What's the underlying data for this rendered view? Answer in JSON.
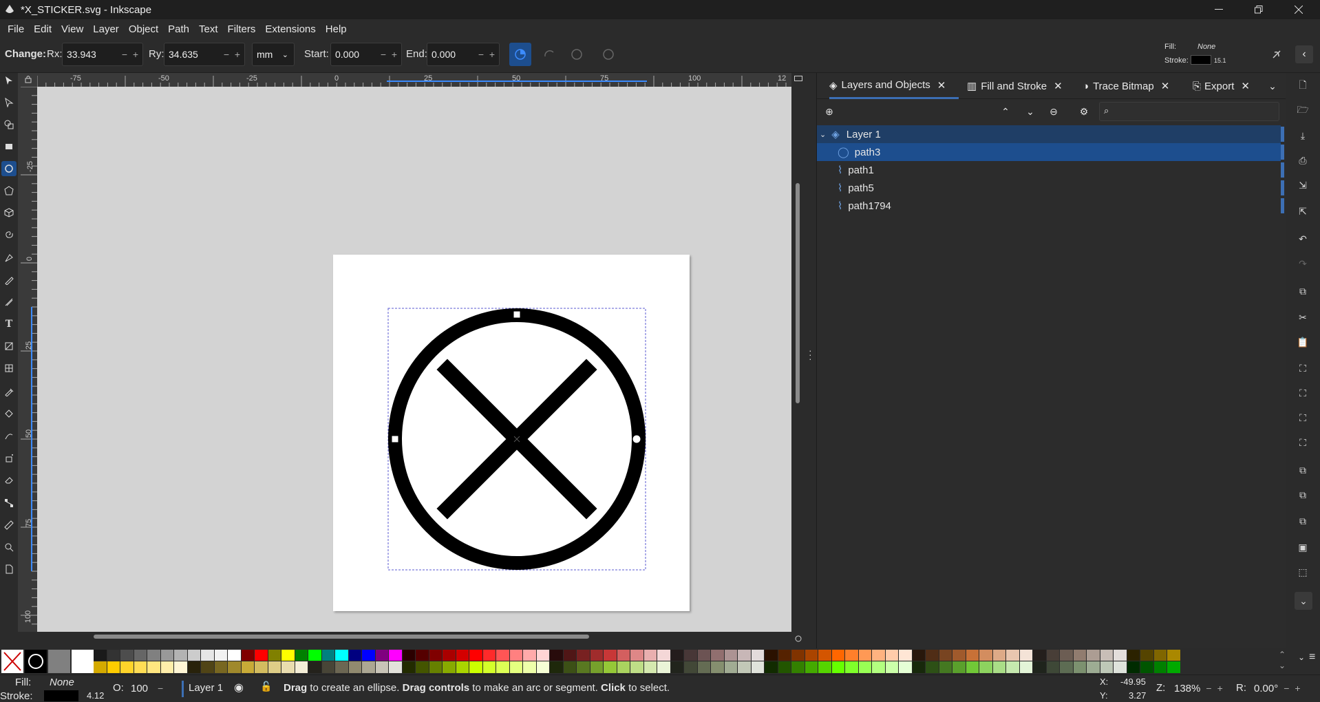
{
  "window": {
    "title": "*X_STICKER.svg - Inkscape"
  },
  "menu": [
    "File",
    "Edit",
    "View",
    "Layer",
    "Object",
    "Path",
    "Text",
    "Filters",
    "Extensions",
    "Help"
  ],
  "toolctl": {
    "change": "Change:",
    "rx_label": "Rx:",
    "rx": "33.943",
    "ry_label": "Ry:",
    "ry": "34.635",
    "unit": "mm",
    "start_label": "Start:",
    "start": "0.000",
    "end_label": "End:",
    "end": "0.000"
  },
  "style_indicator": {
    "fill_label": "Fill:",
    "fill_value": "None",
    "stroke_label": "Stroke:",
    "stroke_width": "15.1"
  },
  "ruler_top": [
    "-75",
    "-50",
    "-25",
    "0",
    "25",
    "50",
    "75",
    "100",
    "12"
  ],
  "ruler_left": [
    "-25",
    "0",
    "25",
    "50",
    "75",
    "100"
  ],
  "tabs": [
    {
      "label": "Layers and Objects",
      "icon": "layers-icon"
    },
    {
      "label": "Fill and Stroke",
      "icon": "fill-stroke-icon"
    },
    {
      "label": "Trace Bitmap",
      "icon": "trace-bitmap-icon"
    },
    {
      "label": "Export",
      "icon": "export-icon"
    }
  ],
  "layers": [
    {
      "label": "Layer 1",
      "type": "layer"
    },
    {
      "label": "path3",
      "type": "ellipse"
    },
    {
      "label": "path1",
      "type": "path"
    },
    {
      "label": "path5",
      "type": "path"
    },
    {
      "label": "path1794",
      "type": "path"
    }
  ],
  "status": {
    "fill_label": "Fill:",
    "fill_value": "None",
    "stroke_label": "Stroke:",
    "stroke_width": "4.12",
    "opacity_label": "O:",
    "opacity": "100",
    "layer": "Layer 1",
    "message_b1": "Drag",
    "message_t1": " to create an ellipse. ",
    "message_b2": "Drag controls",
    "message_t2": " to make an arc or segment. ",
    "message_b3": "Click",
    "message_t3": " to select.",
    "x_label": "X:",
    "x": "-49.95",
    "y_label": "Y:",
    "y": "3.27",
    "zoom_label": "Z:",
    "zoom": "138%",
    "rot_label": "R:",
    "rotation": "0.00°"
  },
  "colors": {
    "accent": "#3c6fb4",
    "selected_row": "#1d4e8e",
    "palette_row1": [
      "#1a1a1a",
      "#333333",
      "#4d4d4d",
      "#666666",
      "#808080",
      "#999999",
      "#b3b3b3",
      "#cccccc",
      "#e6e6e6",
      "#f2f2f2",
      "#ffffff",
      "#800000",
      "#ff0000",
      "#808000",
      "#ffff00",
      "#008000",
      "#00ff00",
      "#008080",
      "#00ffff",
      "#000080",
      "#0000ff",
      "#800080",
      "#ff00ff",
      "#2b0000",
      "#550000",
      "#800000",
      "#aa0000",
      "#d40000",
      "#ff0000",
      "#ff2a2a",
      "#ff5555",
      "#ff8080",
      "#ffaaaa",
      "#ffd5d5",
      "#280b0b",
      "#501616",
      "#782121",
      "#a02c2c",
      "#c83737",
      "#d35f5f",
      "#de8787",
      "#e9afaf",
      "#f4d7d7",
      "#241c1c",
      "#483737",
      "#6c5353",
      "#916f6f",
      "#ac9393",
      "#c8b7b7",
      "#e3dbdb",
      "#2b1100",
      "#552200",
      "#803300",
      "#aa4400",
      "#d45500",
      "#ff6600",
      "#ff7f2a",
      "#ff9955",
      "#ffb380",
      "#ffccaa",
      "#ffe6d5",
      "#28170b",
      "#502d16",
      "#784421",
      "#a05a2c",
      "#c87137",
      "#d38d5f",
      "#deaa87",
      "#e9c6af",
      "#f4e3d7",
      "#241f1c",
      "#483e37",
      "#6c5d53",
      "#917c6f",
      "#ac9d93",
      "#c8beb7",
      "#e3dedb",
      "#2b2200",
      "#554400",
      "#806600",
      "#aa8800"
    ],
    "palette_row2": [
      "#d4aa00",
      "#ffcc00",
      "#ffd42a",
      "#ffdd55",
      "#ffe680",
      "#ffeeaa",
      "#fff6d5",
      "#28220b",
      "#504416",
      "#786721",
      "#a0892c",
      "#c8ab37",
      "#d3bc5f",
      "#decd87",
      "#e9ddaf",
      "#f4eed7",
      "#24221c",
      "#484537",
      "#6c6753",
      "#918a6f",
      "#aca793",
      "#c8c4b7",
      "#e3e2db",
      "#222b00",
      "#445500",
      "#668000",
      "#88aa00",
      "#aad400",
      "#ccff00",
      "#d4ff2a",
      "#ddff55",
      "#e5ff80",
      "#eeffaa",
      "#f6ffd5",
      "#1e280b",
      "#3c5016",
      "#597821",
      "#76a02c",
      "#95c837",
      "#aad35f",
      "#bfde87",
      "#d5e9af",
      "#eaf4d7",
      "#21241c",
      "#424837",
      "#646c53",
      "#858f6f",
      "#a1ac93",
      "#c2c8b7",
      "#e0e3db",
      "#112b00",
      "#225500",
      "#338000",
      "#44aa00",
      "#55d400",
      "#66ff00",
      "#7fff2a",
      "#99ff55",
      "#b3ff80",
      "#ccffaa",
      "#e5ffd5",
      "#17280b",
      "#2d5016",
      "#447821",
      "#5aa02c",
      "#71c837",
      "#8dd35f",
      "#aade87",
      "#c6e9af",
      "#e3f4d7",
      "#1f241c",
      "#3e4837",
      "#5d6c53",
      "#7c916f",
      "#9dac93",
      "#bec8b7",
      "#dee3db",
      "#002b00",
      "#005500",
      "#008000",
      "#00aa00"
    ]
  }
}
